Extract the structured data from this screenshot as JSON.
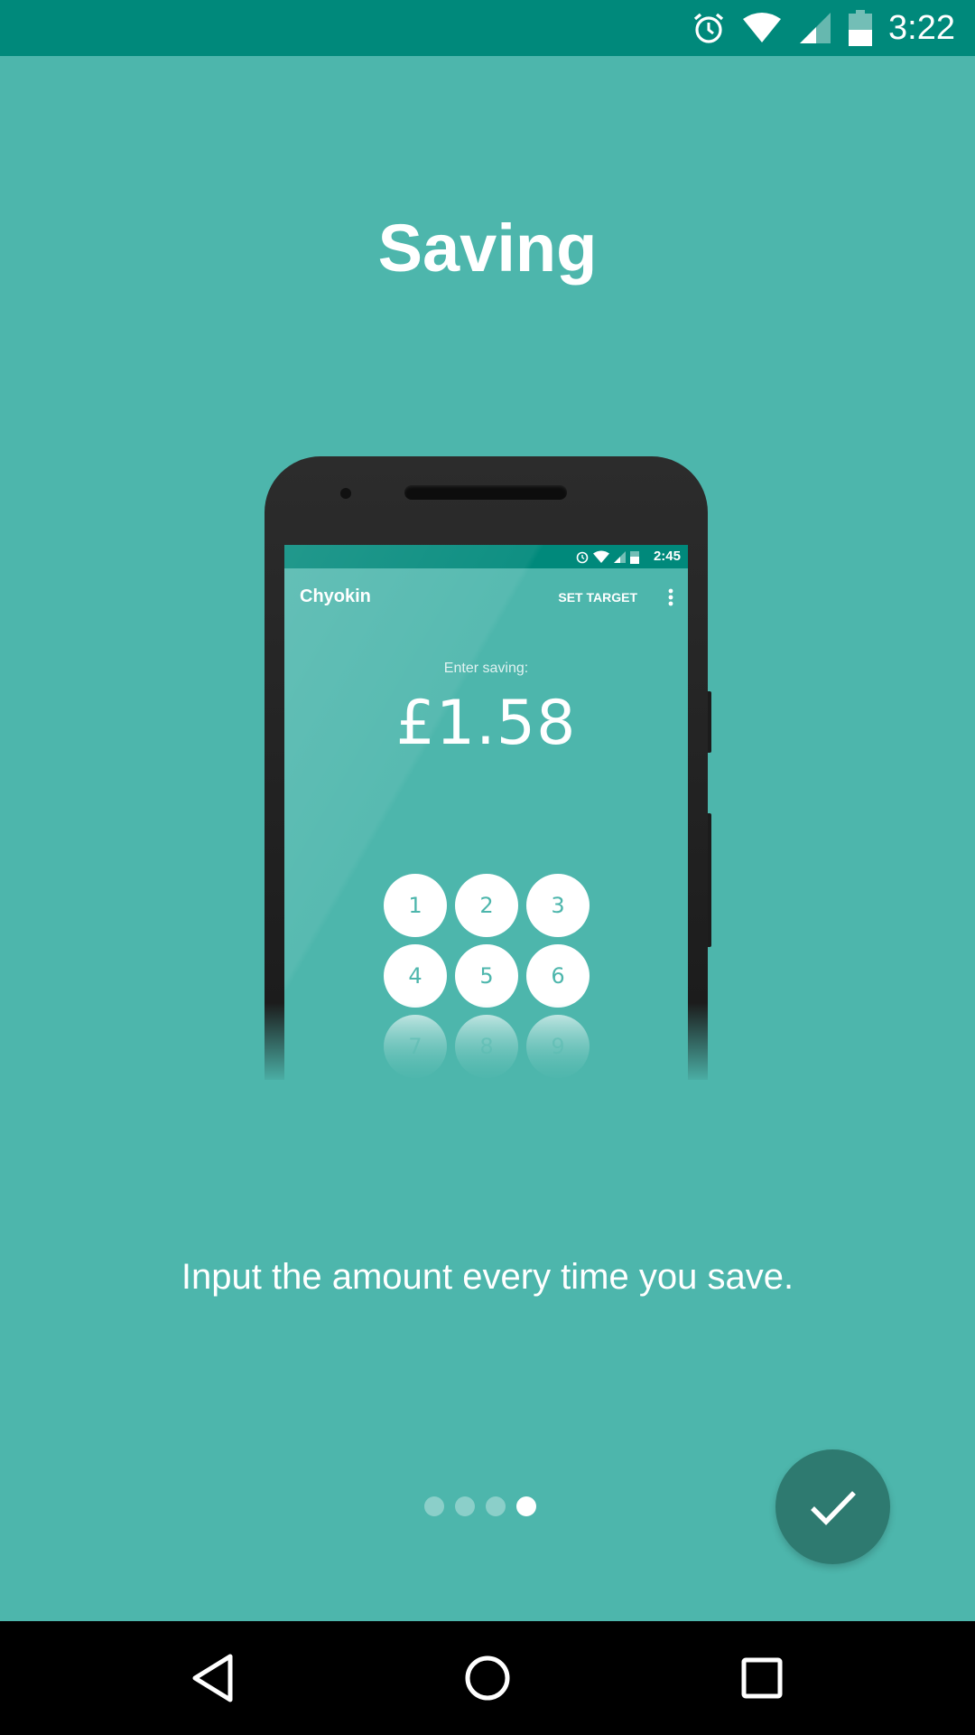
{
  "status_bar": {
    "time": "3:22",
    "icons": [
      "alarm-icon",
      "wifi-icon",
      "cell-signal-icon",
      "battery-icon"
    ],
    "background": "#00897b"
  },
  "onboarding": {
    "title": "Saving",
    "subtitle": "Input the amount every time you save.",
    "page_count": 4,
    "current_page": 4,
    "background": "#4db6ac"
  },
  "illustration": {
    "status_time": "2:45",
    "app_title": "Chyokin",
    "action_label": "SET TARGET",
    "enter_label": "Enter saving:",
    "amount": "£1.58",
    "keys": [
      "1",
      "2",
      "3",
      "4",
      "5",
      "6",
      "7",
      "8",
      "9"
    ]
  },
  "fab": {
    "icon": "check-icon",
    "color": "#2e7a70"
  },
  "nav_bar": {
    "icons": [
      "back-icon",
      "home-icon",
      "recents-icon"
    ]
  }
}
